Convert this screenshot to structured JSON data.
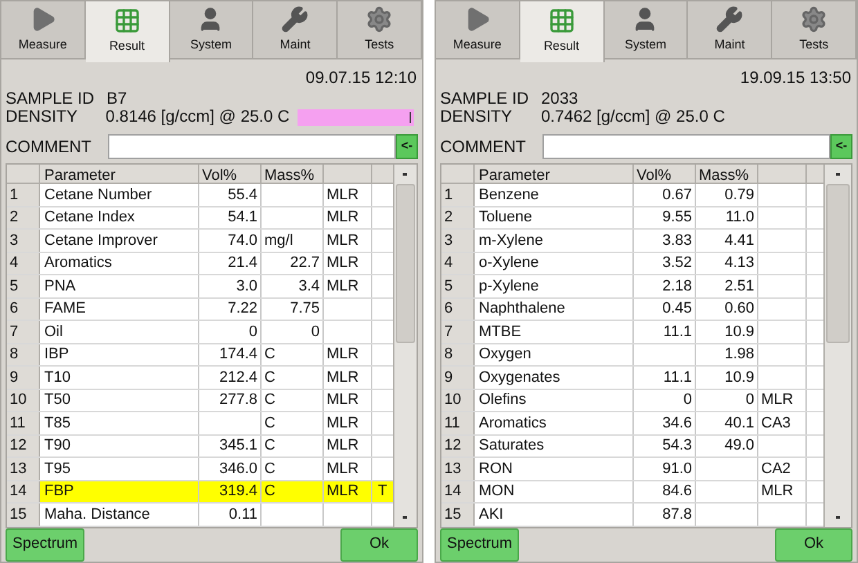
{
  "panels": [
    {
      "tabs": [
        {
          "label": "Measure",
          "kind": "play",
          "selected": false
        },
        {
          "label": "Result",
          "kind": "grid",
          "selected": true
        },
        {
          "label": "System",
          "kind": "user",
          "selected": false
        },
        {
          "label": "Maint",
          "kind": "wrench",
          "selected": false
        },
        {
          "label": "Tests",
          "kind": "gear",
          "selected": false
        }
      ],
      "datetime": "09.07.15 12:10",
      "sample_id_label": "SAMPLE ID",
      "sample_id": "B7",
      "density_label": "DENSITY",
      "density": "0.8146 [g/ccm] @ 25.0 C",
      "density_alert": true,
      "comment_label": "COMMENT",
      "comment_button": "<-",
      "columns": [
        "Parameter",
        "Vol%",
        "Mass%"
      ],
      "rows": [
        {
          "number": "1",
          "parameter": "Cetane Number",
          "vol": "55.4",
          "method": "MLR",
          "selected": false
        },
        {
          "number": "2",
          "parameter": "Cetane Index",
          "vol": "54.1",
          "method": "MLR",
          "selected": false
        },
        {
          "number": "3",
          "parameter": "Cetane Improver",
          "vol": "74.0",
          "unit": "mg/l",
          "method": "MLR",
          "selected": false
        },
        {
          "number": "4",
          "parameter": "Aromatics",
          "vol": "21.4",
          "mass": "22.7",
          "method": "MLR",
          "selected": false
        },
        {
          "number": "5",
          "parameter": "PNA",
          "vol": "3.0",
          "mass": "3.4",
          "method": "MLR",
          "selected": false
        },
        {
          "number": "6",
          "parameter": "FAME",
          "vol": "7.22",
          "mass": "7.75",
          "selected": false
        },
        {
          "number": "7",
          "parameter": "Oil",
          "vol": "0",
          "mass": "0",
          "selected": false
        },
        {
          "number": "8",
          "parameter": "IBP",
          "vol": "174.4",
          "unit": "C",
          "method": "MLR",
          "selected": false
        },
        {
          "number": "9",
          "parameter": "T10",
          "vol": "212.4",
          "unit": "C",
          "method": "MLR",
          "selected": false
        },
        {
          "number": "10",
          "parameter": "T50",
          "vol": "277.8",
          "unit": "C",
          "method": "MLR",
          "selected": false
        },
        {
          "number": "11",
          "parameter": "T85",
          "unit": "C",
          "method": "MLR",
          "selected": false
        },
        {
          "number": "12",
          "parameter": "T90",
          "vol": "345.1",
          "unit": "C",
          "method": "MLR",
          "selected": false
        },
        {
          "number": "13",
          "parameter": "T95",
          "vol": "346.0",
          "unit": "C",
          "method": "MLR",
          "selected": false
        },
        {
          "number": "14",
          "parameter": "FBP",
          "vol": "319.4",
          "unit": "C",
          "method": "MLR",
          "flag": "T",
          "selected": true
        },
        {
          "number": "15",
          "parameter": "Maha. Distance",
          "vol": "0.11",
          "selected": false
        }
      ],
      "spectrum_button": "Spectrum",
      "ok_button": "Ok"
    },
    {
      "tabs": [
        {
          "label": "Measure",
          "kind": "play",
          "selected": false
        },
        {
          "label": "Result",
          "kind": "grid",
          "selected": true
        },
        {
          "label": "System",
          "kind": "user",
          "selected": false
        },
        {
          "label": "Maint",
          "kind": "wrench",
          "selected": false
        },
        {
          "label": "Tests",
          "kind": "gear",
          "selected": false
        }
      ],
      "datetime": "19.09.15 13:50",
      "sample_id_label": "SAMPLE ID",
      "sample_id": "2033",
      "density_label": "DENSITY",
      "density": "0.7462 [g/ccm] @ 25.0 C",
      "density_alert": false,
      "comment_label": "COMMENT",
      "comment_button": "<-",
      "columns": [
        "Parameter",
        "Vol%",
        "Mass%"
      ],
      "rows": [
        {
          "number": "1",
          "parameter": "Benzene",
          "vol": "0.67",
          "mass": "0.79",
          "selected": false
        },
        {
          "number": "2",
          "parameter": "Toluene",
          "vol": "9.55",
          "mass": "11.0",
          "selected": false
        },
        {
          "number": "3",
          "parameter": "m-Xylene",
          "vol": "3.83",
          "mass": "4.41",
          "selected": false
        },
        {
          "number": "4",
          "parameter": "o-Xylene",
          "vol": "3.52",
          "mass": "4.13",
          "selected": false
        },
        {
          "number": "5",
          "parameter": "p-Xylene",
          "vol": "2.18",
          "mass": "2.51",
          "selected": false
        },
        {
          "number": "6",
          "parameter": "Naphthalene",
          "vol": "0.45",
          "mass": "0.60",
          "selected": false
        },
        {
          "number": "7",
          "parameter": "MTBE",
          "vol": "11.1",
          "mass": "10.9",
          "selected": false
        },
        {
          "number": "8",
          "parameter": "Oxygen",
          "mass": "1.98",
          "selected": false
        },
        {
          "number": "9",
          "parameter": "Oxygenates",
          "vol": "11.1",
          "mass": "10.9",
          "selected": false
        },
        {
          "number": "10",
          "parameter": "Olefins",
          "vol": "0",
          "mass": "0",
          "method": "MLR",
          "selected": false
        },
        {
          "number": "11",
          "parameter": "Aromatics",
          "vol": "34.6",
          "mass": "40.1",
          "method": "CA3",
          "selected": false
        },
        {
          "number": "12",
          "parameter": "Saturates",
          "vol": "54.3",
          "mass": "49.0",
          "selected": false
        },
        {
          "number": "13",
          "parameter": "RON",
          "vol": "91.0",
          "method": "CA2",
          "selected": false
        },
        {
          "number": "14",
          "parameter": "MON",
          "vol": "84.6",
          "method": "MLR",
          "selected": false
        },
        {
          "number": "15",
          "parameter": "AKI",
          "vol": "87.8",
          "selected": false
        }
      ],
      "spectrum_button": "Spectrum",
      "ok_button": "Ok"
    }
  ]
}
